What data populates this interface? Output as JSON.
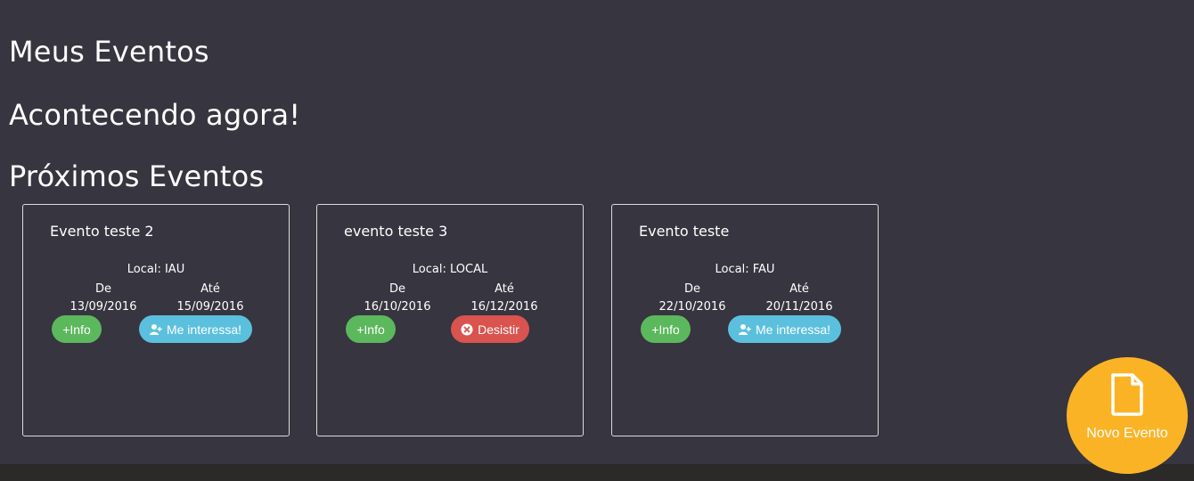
{
  "headings": {
    "meus_eventos": "Meus Eventos",
    "acontecendo_agora": "Acontecendo agora!",
    "proximos_eventos": "Próximos Eventos"
  },
  "events": [
    {
      "title": "Evento teste 2",
      "local": "Local: IAU",
      "from_label": "De",
      "from_date": "13/09/2016",
      "to_label": "Até",
      "to_date": "15/09/2016",
      "info_label": "+Info",
      "action_label": "Me interessa!",
      "action_icon": "user-plus-icon"
    },
    {
      "title": "evento teste 3",
      "local": "Local: LOCAL",
      "from_label": "De",
      "from_date": "16/10/2016",
      "to_label": "Até",
      "to_date": "16/12/2016",
      "info_label": "+Info",
      "action_label": "Desistir",
      "action_icon": "times-circle-icon"
    },
    {
      "title": "Evento teste",
      "local": "Local: FAU",
      "from_label": "De",
      "from_date": "22/10/2016",
      "to_label": "Até",
      "to_date": "20/11/2016",
      "info_label": "+Info",
      "action_label": "Me interessa!",
      "action_icon": "user-plus-icon"
    }
  ],
  "fab": {
    "label": "Novo Evento",
    "icon": "document-icon"
  },
  "colors": {
    "background": "#37353f",
    "footer": "#2b2a28",
    "info_button": "#5cb85c",
    "interest_button": "#5bc0de",
    "withdraw_button": "#d9534f",
    "fab": "#fbb326"
  }
}
